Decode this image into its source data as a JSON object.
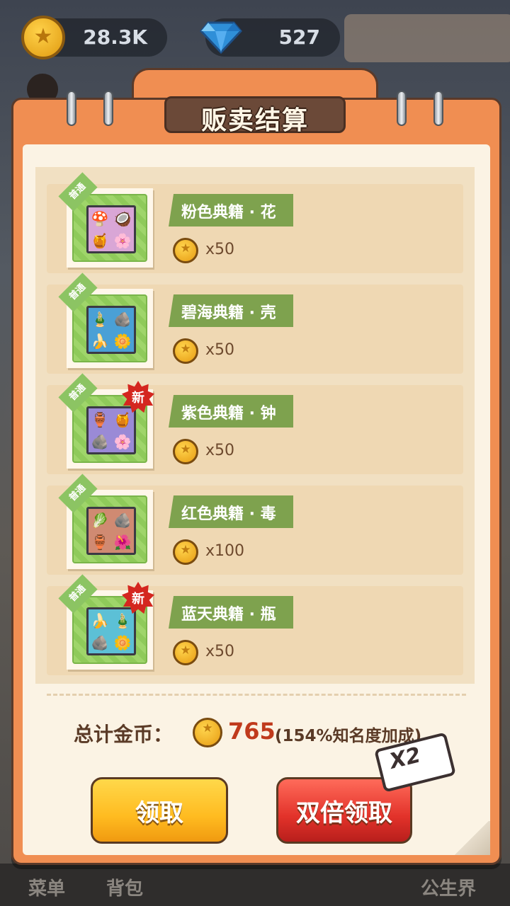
{
  "resources": {
    "coins": "28.3K",
    "gems": "527"
  },
  "dialog": {
    "title": "贩卖结算"
  },
  "items": [
    {
      "rarity": "普通",
      "name": "粉色典籍 · 花",
      "amount": "x50",
      "is_new": false,
      "tile_color": "#d9a6d6",
      "glyphs": [
        "🍄",
        "🥥",
        "🍯",
        "🌸"
      ]
    },
    {
      "rarity": "普通",
      "name": "碧海典籍 · 壳",
      "amount": "x50",
      "is_new": false,
      "tile_color": "#4aa0d6",
      "glyphs": [
        "🎍",
        "🪨",
        "🍌",
        "🌼"
      ]
    },
    {
      "rarity": "普通",
      "name": "紫色典籍 · 钟",
      "amount": "x50",
      "is_new": true,
      "tile_color": "#9a8ad6",
      "glyphs": [
        "🏺",
        "🍯",
        "🪨",
        "🌸"
      ]
    },
    {
      "rarity": "普通",
      "name": "红色典籍 · 毒",
      "amount": "x100",
      "is_new": false,
      "tile_color": "#d08a72",
      "glyphs": [
        "🥬",
        "🪨",
        "🏺",
        "🌺"
      ]
    },
    {
      "rarity": "普通",
      "name": "蓝天典籍 · 瓶",
      "amount": "x50",
      "is_new": true,
      "tile_color": "#5cc0d6",
      "glyphs": [
        "🍌",
        "🎍",
        "🪨",
        "🌼"
      ]
    }
  ],
  "new_badge": "新",
  "total": {
    "label": "总计金币：",
    "value": "765",
    "bonus": "(154%知名度加成)"
  },
  "buttons": {
    "claim": "领取",
    "double_claim": "双倍领取",
    "x2_tag": "X2"
  },
  "bottom_nav": [
    "菜单",
    "背包",
    "公生界"
  ]
}
